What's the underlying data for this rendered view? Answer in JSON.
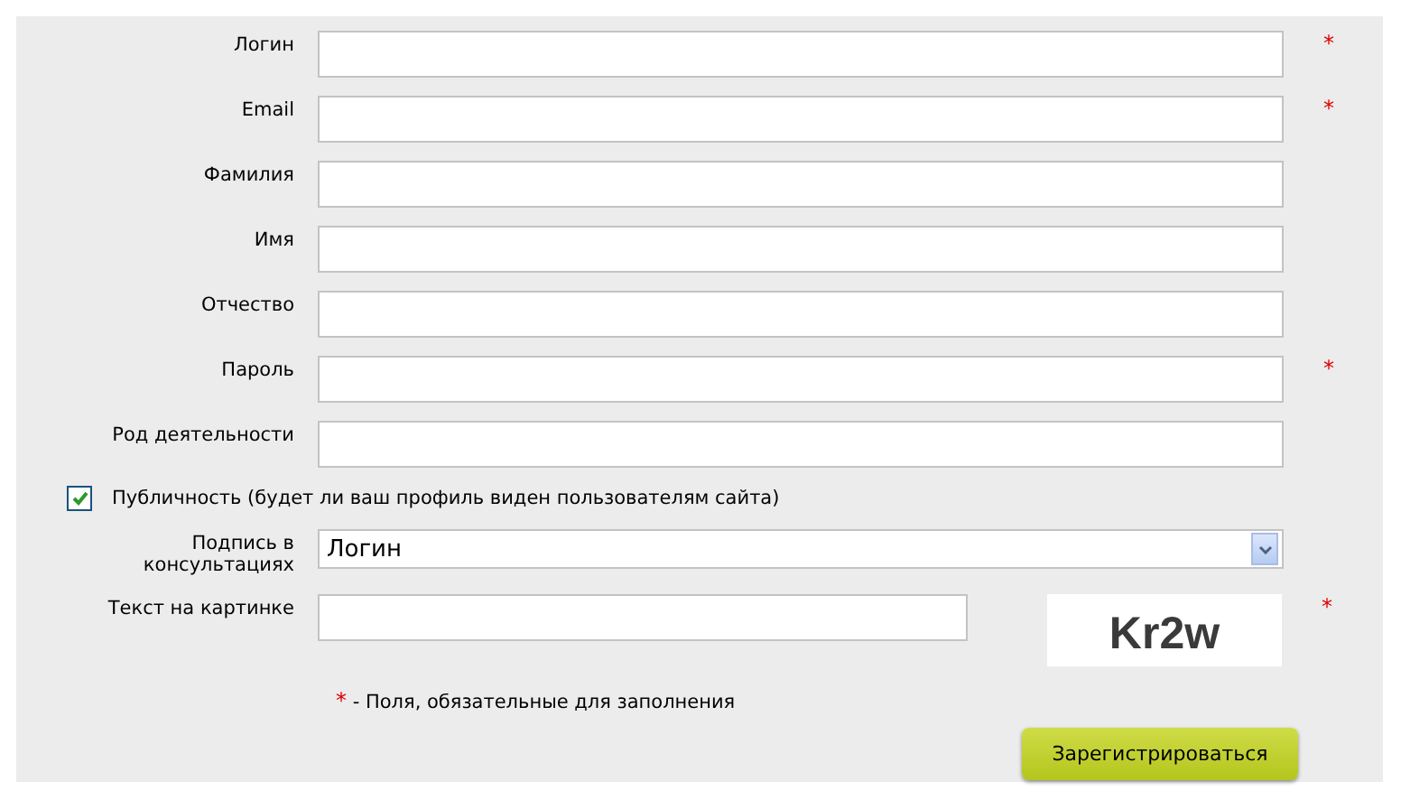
{
  "fields": [
    {
      "label": "Логин",
      "required_mark": "*"
    },
    {
      "label": "Email",
      "required_mark": "*"
    },
    {
      "label": "Фамилия"
    },
    {
      "label": "Имя"
    },
    {
      "label": "Отчество"
    },
    {
      "label": "Пароль",
      "required_mark": "*"
    },
    {
      "label": "Род деятельности"
    }
  ],
  "publicity": {
    "label": "Публичность (будет ли ваш профиль виден пользователям сайта)",
    "checked": true
  },
  "signature": {
    "label": "Подпись в консультациях",
    "value": "Логин"
  },
  "captcha": {
    "label": "Текст на картинке",
    "code": "Kr2w",
    "required_mark": "*"
  },
  "legend": {
    "mark": "*",
    "text": "- Поля, обязательные для заполнения"
  },
  "submit": "Зарегистрироваться"
}
